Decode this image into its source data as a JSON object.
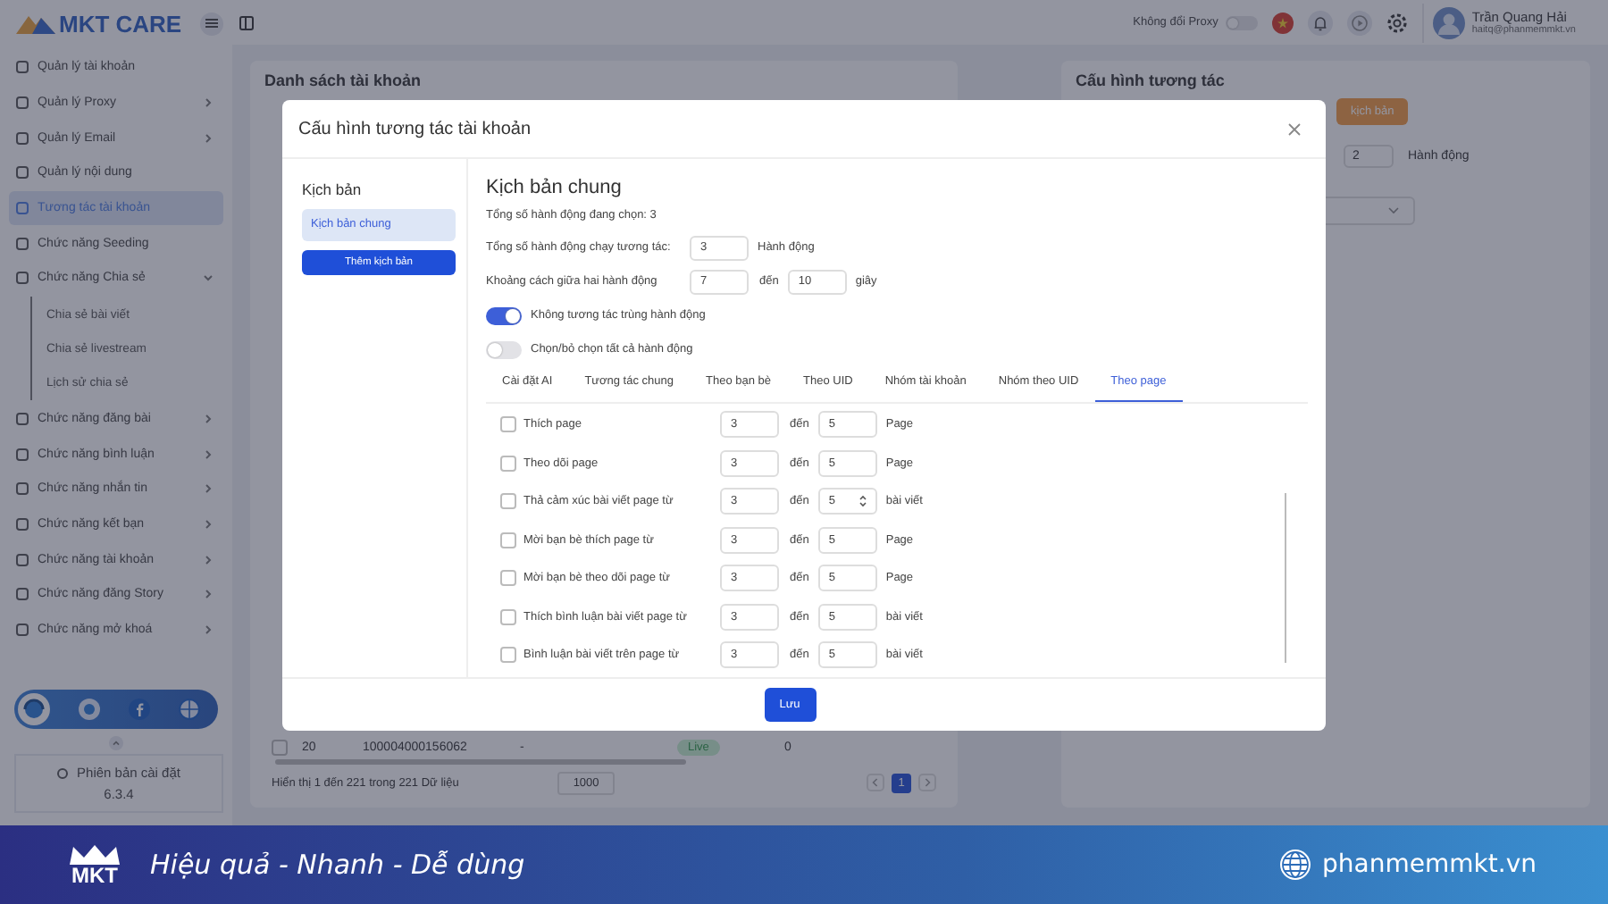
{
  "sidebar": {
    "logo": "MKT CARE",
    "items": [
      {
        "label": "Quản lý tài khoản",
        "selected": false,
        "expandable": false
      },
      {
        "label": "Quản lý Proxy",
        "selected": false,
        "expandable": true,
        "expanded": false
      },
      {
        "label": "Quản lý Email",
        "selected": false,
        "expandable": true,
        "expanded": false
      },
      {
        "label": "Quản lý nội dung",
        "selected": false,
        "expandable": false
      },
      {
        "label": "Tương tác tài khoản",
        "selected": true,
        "expandable": false
      },
      {
        "label": "Chức năng Seeding",
        "selected": false,
        "expandable": false
      },
      {
        "label": "Chức năng Chia sẻ",
        "selected": false,
        "expandable": true,
        "expanded": true,
        "children": [
          {
            "label": "Chia sẻ bài viết",
            "selected": false
          },
          {
            "label": "Chia sẻ livestream",
            "selected": false
          },
          {
            "label": "Lịch sử chia sẻ",
            "selected": false
          }
        ]
      },
      {
        "label": "Chức năng đăng bài",
        "selected": false,
        "expandable": true,
        "expanded": false
      },
      {
        "label": "Chức năng bình luận",
        "selected": false,
        "expandable": true,
        "expanded": false
      },
      {
        "label": "Chức năng nhắn tin",
        "selected": false,
        "expandable": true,
        "expanded": false
      },
      {
        "label": "Chức năng kết bạn",
        "selected": false,
        "expandable": true,
        "expanded": false
      },
      {
        "label": "Chức năng tài khoản",
        "selected": false,
        "expandable": true,
        "expanded": false
      },
      {
        "label": "Chức năng đăng Story",
        "selected": false,
        "expandable": true,
        "expanded": false
      },
      {
        "label": "Chức năng mở khoá",
        "selected": false,
        "expandable": true,
        "expanded": false
      }
    ],
    "version_label": "Phiên bản cài đặt",
    "version": "6.3.4"
  },
  "topbar": {
    "proxy_label": "Không đổi Proxy",
    "proxy_on": false,
    "user_name": "Trần Quang Hải",
    "user_email": "haitq@phanmemmkt.vn"
  },
  "accounts_panel": {
    "title": "Danh sách tài khoản",
    "rows": [
      {
        "checked": false,
        "cells": [
          "20",
          "100004000156062",
          "-",
          "Live",
          "0"
        ]
      }
    ],
    "footer": "Hiển thị 1 đến 221 trong 221 Dữ liệu",
    "page_size": "1000",
    "pages": [
      {
        "label": "1",
        "selected": true
      }
    ]
  },
  "config_panel": {
    "title": "Cấu hình tương tác",
    "add_button": "kịch bản",
    "count": "2",
    "unit": "Hành động"
  },
  "dialog": {
    "title": "Cấu hình tương tác tài khoản",
    "scripts_heading": "Kịch bản",
    "scripts": [
      {
        "label": "Kịch bản chung",
        "selected": true
      }
    ],
    "add_button": "Thêm kịch bản",
    "heading": "Kịch bản chung",
    "selected_count": "Tổng số hành động đang chọn: 3",
    "fields": [
      {
        "label": "Tổng số hành động chạy tương tác:",
        "from": "3",
        "unit": "Hành động"
      },
      {
        "label": "Khoảng cách giữa hai hành động",
        "from": "7",
        "sep": "đến",
        "to": "10",
        "unit": "giây"
      }
    ],
    "toggles": [
      {
        "label": "Không tương tác trùng hành động",
        "on": true
      },
      {
        "label": "Chọn/bỏ chọn tất cả hành động",
        "on": false
      }
    ],
    "tabs": [
      {
        "label": "Cài đặt AI",
        "selected": false
      },
      {
        "label": "Tương tác chung",
        "selected": false
      },
      {
        "label": "Theo bạn bè",
        "selected": false
      },
      {
        "label": "Theo UID",
        "selected": false
      },
      {
        "label": "Nhóm tài khoản",
        "selected": false
      },
      {
        "label": "Nhóm theo UID",
        "selected": false
      },
      {
        "label": "Theo page",
        "selected": true
      }
    ],
    "actions": [
      {
        "label": "Thích page",
        "checked": false,
        "from": "3",
        "sep": "đến",
        "to": "5",
        "unit": "Page",
        "spinner": false
      },
      {
        "label": "Theo dõi page",
        "checked": false,
        "from": "3",
        "sep": "đến",
        "to": "5",
        "unit": "Page",
        "spinner": false
      },
      {
        "label": "Thả cảm xúc bài viết page từ",
        "checked": false,
        "from": "3",
        "sep": "đến",
        "to": "5",
        "unit": "bài viết",
        "spinner": true
      },
      {
        "label": "Mời bạn bè thích page từ",
        "checked": false,
        "from": "3",
        "sep": "đến",
        "to": "5",
        "unit": "Page",
        "spinner": false
      },
      {
        "label": "Mời bạn bè theo dõi page từ",
        "checked": false,
        "from": "3",
        "sep": "đến",
        "to": "5",
        "unit": "Page",
        "spinner": false
      },
      {
        "label": "Thích bình luận bài viết page từ",
        "checked": false,
        "from": "3",
        "sep": "đến",
        "to": "5",
        "unit": "bài viết",
        "spinner": false
      },
      {
        "label": "Bình luận bài viết trên page từ",
        "checked": false,
        "from": "3",
        "sep": "đến",
        "to": "5",
        "unit": "bài viết",
        "spinner": false
      }
    ],
    "save_button": "Lưu"
  },
  "banner": {
    "logo": "MKT",
    "slogan": "Hiệu quả - Nhanh - Dễ dùng",
    "website": "phanmemmkt.vn"
  }
}
